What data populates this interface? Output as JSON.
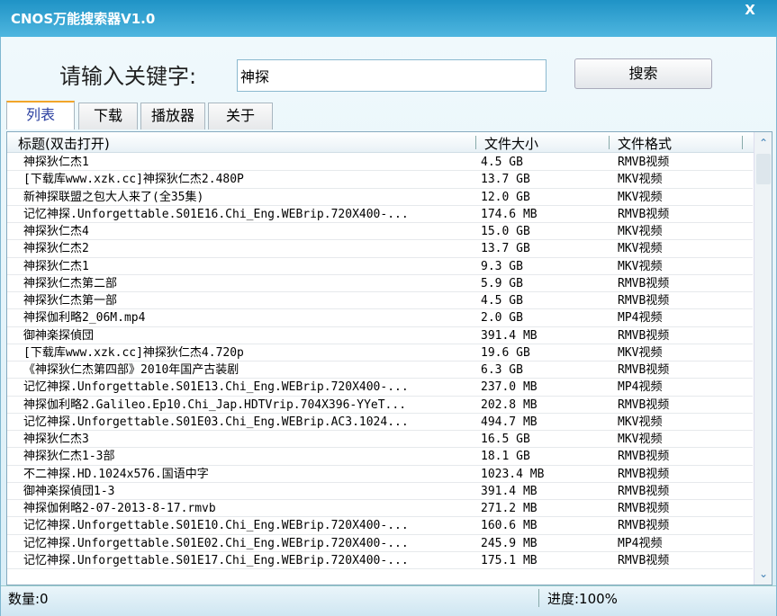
{
  "window": {
    "title": "CNOS万能搜索器V1.0",
    "close": "X"
  },
  "search": {
    "label": "请输入关键字:",
    "value": "神探",
    "button": "搜索"
  },
  "tabs": [
    {
      "label": "列表",
      "active": true
    },
    {
      "label": "下载"
    },
    {
      "label": "播放器"
    },
    {
      "label": "关于"
    }
  ],
  "table": {
    "headers": [
      "标题(双击打开)",
      "文件大小",
      "文件格式"
    ],
    "rows": [
      [
        "神探狄仁杰1",
        "4.5 GB",
        "RMVB视频"
      ],
      [
        "[下载库www.xzk.cc]神探狄仁杰2.480P",
        "13.7 GB",
        "MKV视频"
      ],
      [
        "新神探联盟之包大人来了(全35集)",
        "12.0 GB",
        "MKV视频"
      ],
      [
        "记忆神探.Unforgettable.S01E16.Chi_Eng.WEBrip.720X400-...",
        "174.6 MB",
        "RMVB视频"
      ],
      [
        "神探狄仁杰4",
        "15.0 GB",
        "MKV视频"
      ],
      [
        "神探狄仁杰2",
        "13.7 GB",
        "MKV视频"
      ],
      [
        "神探狄仁杰1",
        "9.3 GB",
        "MKV视频"
      ],
      [
        "神探狄仁杰第二部",
        "5.9 GB",
        "RMVB视频"
      ],
      [
        "神探狄仁杰第一部",
        "4.5 GB",
        "RMVB视频"
      ],
      [
        "神探伽利略2_06M.mp4",
        "2.0 GB",
        "MP4视频"
      ],
      [
        "御神楽探偵団",
        "391.4 MB",
        "RMVB视频"
      ],
      [
        "[下载库www.xzk.cc]神探狄仁杰4.720p",
        "19.6 GB",
        "MKV视频"
      ],
      [
        "《神探狄仁杰第四部》2010年国产古装剧",
        "6.3 GB",
        "RMVB视频"
      ],
      [
        "记忆神探.Unforgettable.S01E13.Chi_Eng.WEBrip.720X400-...",
        "237.0 MB",
        "MP4视频"
      ],
      [
        "神探伽利略2.Galileo.Ep10.Chi_Jap.HDTVrip.704X396-YYeT...",
        "202.8 MB",
        "RMVB视频"
      ],
      [
        "记忆神探.Unforgettable.S01E03.Chi_Eng.WEBrip.AC3.1024...",
        "494.7 MB",
        "MKV视频"
      ],
      [
        "神探狄仁杰3",
        "16.5 GB",
        "MKV视频"
      ],
      [
        "神探狄仁杰1-3部",
        "18.1 GB",
        "RMVB视频"
      ],
      [
        "不二神探.HD.1024x576.国语中字",
        "1023.4 MB",
        "RMVB视频"
      ],
      [
        "御神楽探偵団1-3",
        "391.4 MB",
        "RMVB视频"
      ],
      [
        "神探伽俐略2-07-2013-8-17.rmvb",
        "271.2 MB",
        "RMVB视频"
      ],
      [
        "记忆神探.Unforgettable.S01E10.Chi_Eng.WEBrip.720X400-...",
        "160.6 MB",
        "RMVB视频"
      ],
      [
        "记忆神探.Unforgettable.S01E02.Chi_Eng.WEBrip.720X400-...",
        "245.9 MB",
        "MP4视频"
      ],
      [
        "记忆神探.Unforgettable.S01E17.Chi_Eng.WEBrip.720X400-...",
        "175.1 MB",
        "RMVB视频"
      ]
    ]
  },
  "scrollbar": {
    "up": "⌃",
    "down": "⌄"
  },
  "status": {
    "count": "数量:0",
    "progress": "进度:100%"
  }
}
